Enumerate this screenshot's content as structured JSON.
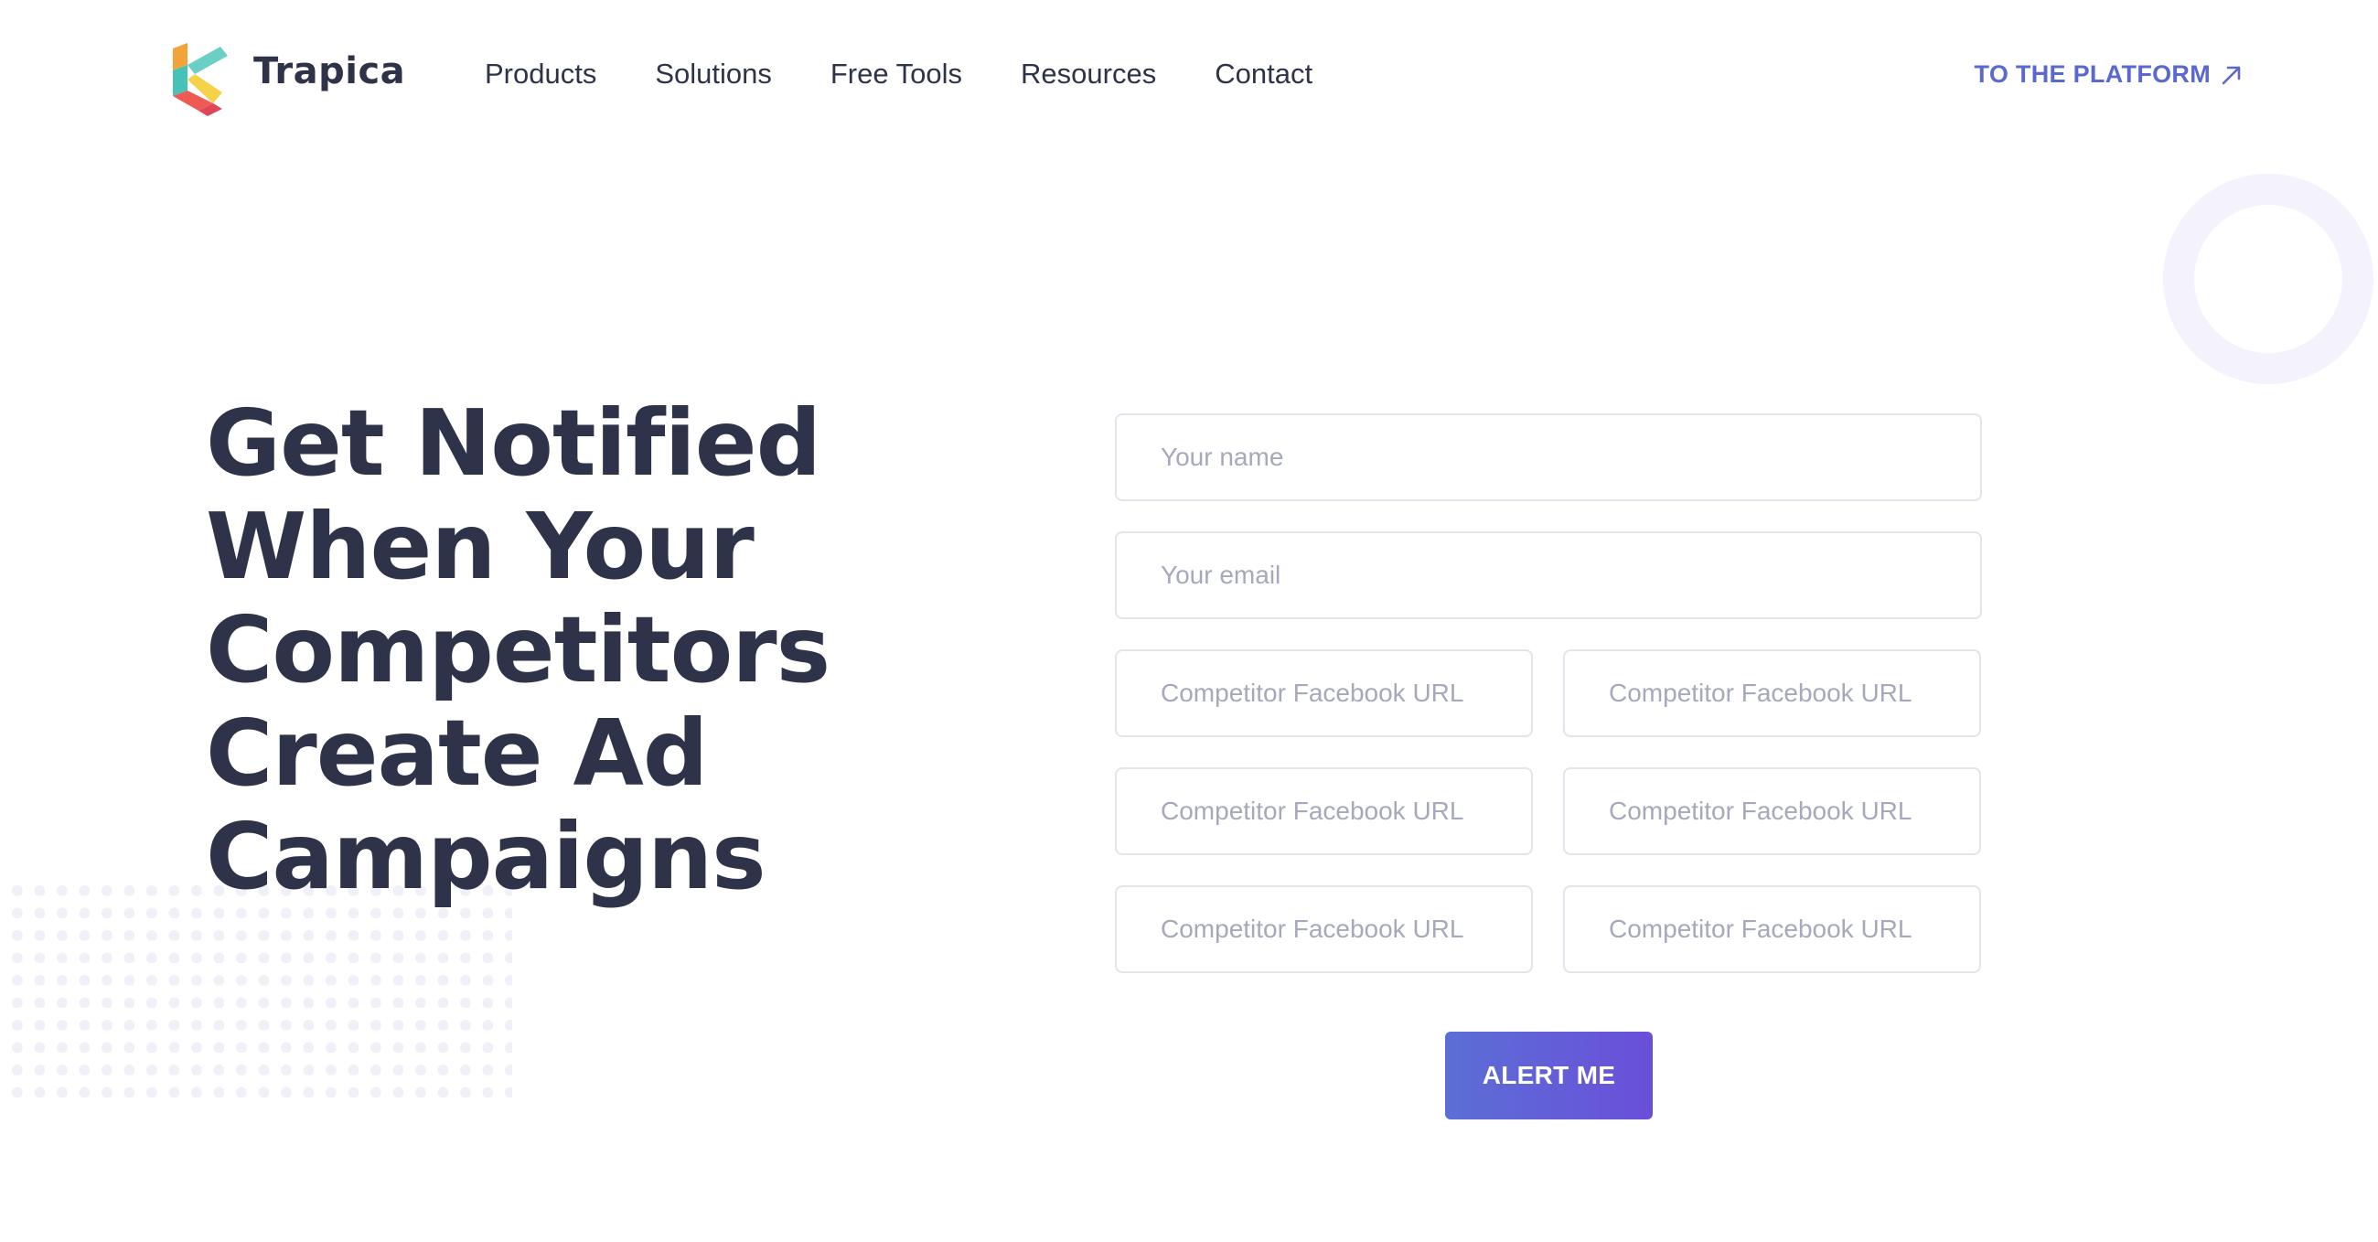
{
  "header": {
    "brand": "Trapica",
    "nav": [
      "Products",
      "Solutions",
      "Free Tools",
      "Resources",
      "Contact"
    ],
    "platform_link": "TO THE PLATFORM"
  },
  "hero": {
    "title_lines": [
      "Get Notified",
      "When Your",
      "Competitors",
      "Create Ad",
      "Campaigns"
    ]
  },
  "form": {
    "name_placeholder": "Your name",
    "email_placeholder": "Your email",
    "competitor_placeholder": "Competitor Facebook URL",
    "submit_label": "ALERT ME"
  },
  "colors": {
    "text": "#2f3349",
    "accent": "#5b69cf",
    "button_gradient_start": "#5b6fd6",
    "button_gradient_end": "#6a4fd9"
  }
}
